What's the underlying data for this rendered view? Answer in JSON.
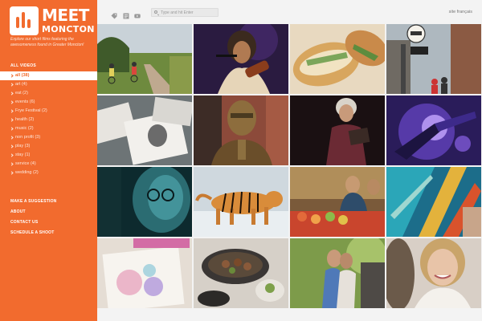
{
  "brand": {
    "line1": "MEET",
    "line2": "MONCTON",
    "tagline": "Explore our short films featuring the awesomeness found in Greater Moncton!",
    "accent": "#f26b2e"
  },
  "sidebar": {
    "section_title": "ALL VIDEOS",
    "categories": [
      {
        "label": "all (38)",
        "active": true
      },
      {
        "label": "art (4)"
      },
      {
        "label": "eat (2)"
      },
      {
        "label": "events (6)"
      },
      {
        "label": "Frye Festival (2)"
      },
      {
        "label": "health (2)"
      },
      {
        "label": "music (2)"
      },
      {
        "label": "non profit (3)"
      },
      {
        "label": "play (3)"
      },
      {
        "label": "stay (1)"
      },
      {
        "label": "service (4)"
      },
      {
        "label": "wedding (2)"
      }
    ],
    "links": [
      "MAKE A SUGGESTION",
      "ABOUT",
      "CONTACT US",
      "SCHEDULE A SHOOT"
    ]
  },
  "topbar": {
    "icons": [
      "tag-icon",
      "document-icon",
      "youtube-icon"
    ],
    "search_placeholder": "Type and hit Enter",
    "language_link": "site français"
  },
  "tiles": [
    {
      "name": "tile-cyclists-path"
    },
    {
      "name": "tile-violinist-singer"
    },
    {
      "name": "tile-banh-mi-sandwich"
    },
    {
      "name": "tile-street-sign"
    },
    {
      "name": "tile-photo-prints"
    },
    {
      "name": "tile-bronze-statue"
    },
    {
      "name": "tile-poetry-reader"
    },
    {
      "name": "tile-purple-stage-lights"
    },
    {
      "name": "tile-teal-portrait"
    },
    {
      "name": "tile-tiger"
    },
    {
      "name": "tile-market-vendors"
    },
    {
      "name": "tile-abstract-painting"
    },
    {
      "name": "tile-watercolour-drawing"
    },
    {
      "name": "tile-plated-dish"
    },
    {
      "name": "tile-couple-embrace"
    },
    {
      "name": "tile-smiling-bride"
    }
  ]
}
